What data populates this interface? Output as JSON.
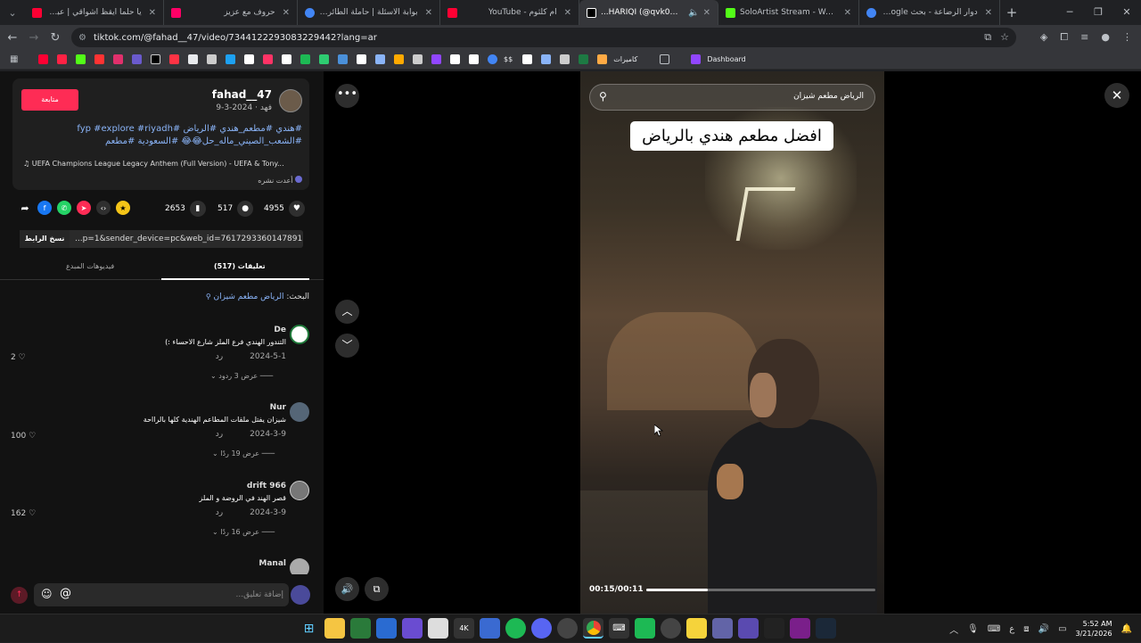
{
  "browser": {
    "tabs": [
      {
        "title": "يا حلماً أيقظ أشواقي | عبدالله الم...",
        "favicon_color": "#ff0033",
        "active": false
      },
      {
        "title": "حروف مع عزيز",
        "favicon_color": "#ff0066",
        "active": false
      },
      {
        "title": "بوابة الأسئلة | حاملة الطائرات جيرالد فورد - بحث...",
        "favicon_color": "#4285f4",
        "active": false
      },
      {
        "title": "ام كلثوم - YouTube",
        "favicon_color": "#ff0033",
        "active": false
      },
      {
        "title": "...HARIQI (@qvk0_) | TikTok",
        "favicon_color": "#ffffff",
        "active": true
      },
      {
        "title": "SoloArtist Stream - Watch Live",
        "favicon_color": "#53fc18",
        "active": false
      },
      {
        "title": "دوار الرضاعة - بحث Google",
        "favicon_color": "#4285f4",
        "active": false
      }
    ],
    "url": "tiktok.com/@fahad__47/video/7344122293083229442?lang=ar",
    "bookmarks": {
      "folder_label": "كاميرات",
      "dashboard_label": "Dashboard",
      "dollar_label": "$$",
      "icon_colors": [
        "#ff0033",
        "#ff2244",
        "#53fc18",
        "#ff3333",
        "#e1306c",
        "#6a5acd",
        "#ffffff",
        "#ff3344",
        "#e8eaed",
        "#e8eaed",
        "#1da1f2",
        "#ffffff",
        "#ffcc00",
        "#ff3366",
        "#ffffff",
        "#1db954",
        "#2ecc71",
        "#4a90d9",
        "#ffffff",
        "#8ab4f8",
        "#ffaa00",
        "#cccccc",
        "#9146ff",
        "#ffffff",
        "#ffffff"
      ]
    }
  },
  "post": {
    "follow_label": "متابعة",
    "username": "fahad__47",
    "date": "فهد · 2024-3-9",
    "hashtags_line1": "#هندي #مطعم_هندي #الرياض #fyp #explore #riyadh",
    "hashtags_line2": "#الشعب_الصيني_ماله_حل😂😂 #السعودية #مطعم",
    "music": "♫ UEFA Champions League Legacy Anthem (Full Version) - UEFA & Tony...",
    "repost": "أعدت نشره",
    "likes": "4955",
    "comments": "517",
    "saves": "2653",
    "copy_link_label": "نسخ الرابط",
    "link_fragment": "...p=1&sender_device=pc&web_id=7617293360147891730"
  },
  "tabs": {
    "comments_label": "تعليقات (517)",
    "creator_videos_label": "فيديوهات المبدع"
  },
  "search": {
    "prefix": "البحث:",
    "query": "الرياض مطعم شيزان"
  },
  "comments": [
    {
      "name": "De",
      "text": "التندور الهندي فرع الملز شارع الاحساء :)",
      "date": "2024-5-1",
      "reply": "رد",
      "likes": "2",
      "replies": "عرض 3 ردود",
      "avatar_color": "#1f7a3a"
    },
    {
      "name": "Nur",
      "text": "شيزان يفتل ملقات المطاعم الهندية كلها بالرااحة",
      "date": "2024-3-9",
      "reply": "رد",
      "likes": "100",
      "replies": "عرض 19 ردًا",
      "avatar_color": "#556677"
    },
    {
      "name": "drift 966",
      "text": "قصر الهند في الروضة و الملز",
      "date": "2024-3-9",
      "reply": "رد",
      "likes": "162",
      "replies": "عرض 16 ردًا",
      "avatar_color": "#777777"
    },
    {
      "name": "Manal",
      "text": "",
      "date": "",
      "reply": "",
      "likes": "",
      "replies": "",
      "avatar_color": "#aaaaaa"
    }
  ],
  "input": {
    "placeholder": "إضافة تعليق..."
  },
  "video": {
    "search_text": "الرياض مطعم شيزان",
    "caption": "افضل مطعم هندي بالرياض",
    "time": "00:15/00:11",
    "progress": 0.27
  },
  "taskbar": {
    "time": "5:52 AM",
    "date": "3/21/2026",
    "lang": "ع"
  }
}
